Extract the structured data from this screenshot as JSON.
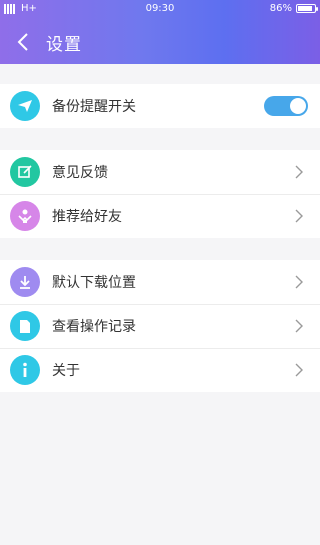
{
  "status_bar": {
    "network": "H+",
    "time": "09:30",
    "battery": "86%",
    "battery_level": 0.86
  },
  "header": {
    "title": "设置",
    "back_icon": "chevron-left-icon"
  },
  "groups": [
    {
      "items": [
        {
          "label": "备份提醒开关",
          "icon": "paper-plane-icon",
          "icon_color": "#2fc8e6",
          "control": "toggle",
          "toggle_on": true
        }
      ]
    },
    {
      "items": [
        {
          "label": "意见反馈",
          "icon": "edit-icon",
          "icon_color": "#22c7a1",
          "control": "chevron"
        },
        {
          "label": "推荐给好友",
          "icon": "share-gift-icon",
          "icon_color": "#d686e8",
          "control": "chevron"
        }
      ]
    },
    {
      "items": [
        {
          "label": "默认下载位置",
          "icon": "download-icon",
          "icon_color": "#9f8bf0",
          "control": "chevron"
        },
        {
          "label": "查看操作记录",
          "icon": "document-icon",
          "icon_color": "#2fc8e6",
          "control": "chevron"
        },
        {
          "label": "关于",
          "icon": "info-icon",
          "icon_color": "#2fc8e6",
          "control": "chevron"
        }
      ]
    }
  ],
  "colors": {
    "header_gradient": [
      "#8f6ee9",
      "#5d6ff0"
    ],
    "toggle_on": "#47a7ea",
    "background": "#f5f5f7"
  }
}
